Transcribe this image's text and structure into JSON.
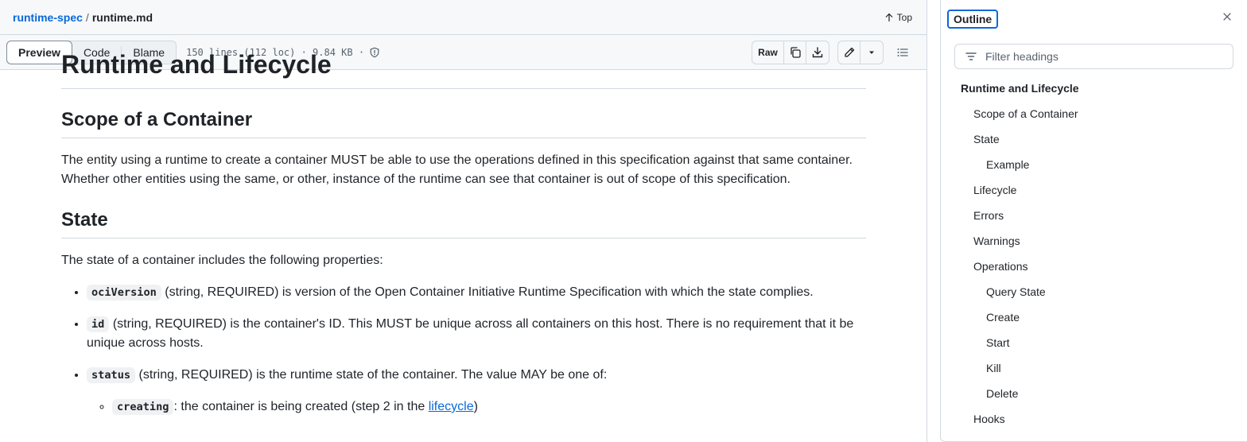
{
  "breadcrumb": {
    "repo": "runtime-spec",
    "separator": "/",
    "file": "runtime.md"
  },
  "top_label": "Top",
  "view_tabs": [
    {
      "label": "Preview",
      "active": true
    },
    {
      "label": "Code",
      "active": false
    },
    {
      "label": "Blame",
      "active": false
    }
  ],
  "file_meta": "150 lines (112 loc) · 9.84 KB ·",
  "toolbar": {
    "raw_label": "Raw"
  },
  "doc": {
    "h1": "Runtime and Lifecycle",
    "scope_heading": "Scope of a Container",
    "scope_text": "The entity using a runtime to create a container MUST be able to use the operations defined in this specification against that same container. Whether other entities using the same, or other, instance of the runtime can see that container is out of scope of this specification.",
    "state_heading": "State",
    "state_intro": "The state of a container includes the following properties:",
    "props": [
      {
        "code": "ociVersion",
        "text": " (string, REQUIRED) is version of the Open Container Initiative Runtime Specification with which the state complies."
      },
      {
        "code": "id",
        "text": " (string, REQUIRED) is the container's ID. This MUST be unique across all containers on this host. There is no requirement that it be unique across hosts."
      },
      {
        "code": "status",
        "text": " (string, REQUIRED) is the runtime state of the container. The value MAY be one of:"
      }
    ],
    "status_values": [
      {
        "code": "creating",
        "text_before": ": the container is being created (step 2 in the ",
        "link": "lifecycle",
        "text_after": ")"
      }
    ]
  },
  "outline": {
    "title": "Outline",
    "filter_placeholder": "Filter headings",
    "headings": [
      {
        "label": "Runtime and Lifecycle",
        "level": 1
      },
      {
        "label": "Scope of a Container",
        "level": 2
      },
      {
        "label": "State",
        "level": 2
      },
      {
        "label": "Example",
        "level": 3
      },
      {
        "label": "Lifecycle",
        "level": 2
      },
      {
        "label": "Errors",
        "level": 2
      },
      {
        "label": "Warnings",
        "level": 2
      },
      {
        "label": "Operations",
        "level": 2
      },
      {
        "label": "Query State",
        "level": 3
      },
      {
        "label": "Create",
        "level": 3
      },
      {
        "label": "Start",
        "level": 3
      },
      {
        "label": "Kill",
        "level": 3
      },
      {
        "label": "Delete",
        "level": 3
      },
      {
        "label": "Hooks",
        "level": 2
      }
    ]
  },
  "icons": {
    "top": "arrow-up-icon",
    "meta": "shield-icon",
    "copy": "copy-icon",
    "download": "download-icon",
    "edit": "pencil-icon",
    "more": "triangle-down-icon",
    "symbols": "list-unordered-icon",
    "close": "x-icon",
    "filter": "filter-icon"
  },
  "colors": {
    "link": "#0969da",
    "border": "#d1d9e0",
    "muted": "#59636e",
    "text": "#1f2328"
  }
}
